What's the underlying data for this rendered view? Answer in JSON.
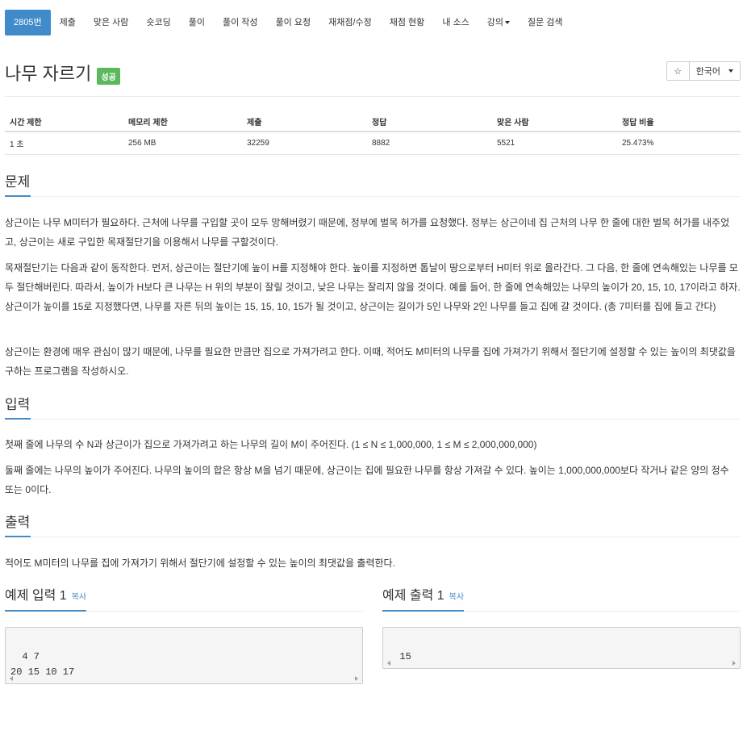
{
  "nav": {
    "tabs": [
      "2805번",
      "제출",
      "맞은 사람",
      "숏코딩",
      "풀이",
      "풀이 작성",
      "풀이 요청",
      "재채점/수정",
      "채점 현황",
      "내 소스",
      "강의",
      "질문 검색"
    ]
  },
  "problem": {
    "title": "나무 자르기",
    "status": "성공"
  },
  "toolbar": {
    "star_icon": "☆",
    "language": "한국어"
  },
  "info": {
    "headers": [
      "시간 제한",
      "메모리 제한",
      "제출",
      "정답",
      "맞은 사람",
      "정답 비율"
    ],
    "values": [
      "1 초",
      "256 MB",
      "32259",
      "8882",
      "5521",
      "25.473%"
    ]
  },
  "sections": {
    "description": {
      "heading": "문제",
      "paragraphs": [
        "상근이는 나무 M미터가 필요하다. 근처에 나무를 구입할 곳이 모두 망해버렸기 때문에, 정부에 벌목 허가를 요청했다. 정부는 상근이네 집 근처의 나무 한 줄에 대한 벌목 허가를 내주었고, 상근이는 새로 구입한 목재절단기을 이용해서 나무를 구할것이다.",
        "목재절단기는 다음과 같이 동작한다. 먼저, 상근이는 절단기에 높이 H를 지정해야 한다. 높이를 지정하면 톱날이 땅으로부터 H미터 위로 올라간다. 그 다음, 한 줄에 연속해있는 나무를 모두 절단해버린다. 따라서, 높이가 H보다 큰 나무는 H 위의 부분이 잘릴 것이고, 낮은 나무는 잘리지 않을 것이다. 예를 들어, 한 줄에 연속해있는 나무의 높이가 20, 15, 10, 17이라고 하자. 상근이가 높이를 15로 지정했다면, 나무를 자른 뒤의 높이는 15, 15, 10, 15가 될 것이고, 상근이는 길이가 5인 나무와 2인 나무를 들고 집에 갈 것이다. (총 7미터를 집에 들고 간다)",
        "상근이는 환경에 매우 관심이 많기 때문에, 나무를 필요한 만큼만 집으로 가져가려고 한다. 이때, 적어도 M미터의 나무를 집에 가져가기 위해서 절단기에 설정할 수 있는 높이의 최댓값을 구하는 프로그램을 작성하시오."
      ]
    },
    "input": {
      "heading": "입력",
      "paragraphs": [
        "첫째 줄에 나무의 수 N과 상근이가 집으로 가져가려고 하는 나무의 길이 M이 주어진다. (1 ≤ N ≤ 1,000,000, 1 ≤ M ≤ 2,000,000,000)",
        "둘째 줄에는 나무의 높이가 주어진다. 나무의 높이의 합은 항상 M을 넘기 때문에, 상근이는 집에 필요한 나무를 항상 가져갈 수 있다. 높이는 1,000,000,000보다 작거나 같은 양의 정수 또는 0이다."
      ]
    },
    "output": {
      "heading": "출력",
      "paragraphs": [
        "적어도 M미터의 나무를 집에 가져가기 위해서 절단기에 설정할 수 있는 높이의 최댓값을 출력한다."
      ]
    }
  },
  "examples": {
    "input_title": "예제 입력 1",
    "output_title": "예제 출력 1",
    "copy_label": "복사",
    "input_text": "4 7\n20 15 10 17",
    "output_text": "15"
  }
}
